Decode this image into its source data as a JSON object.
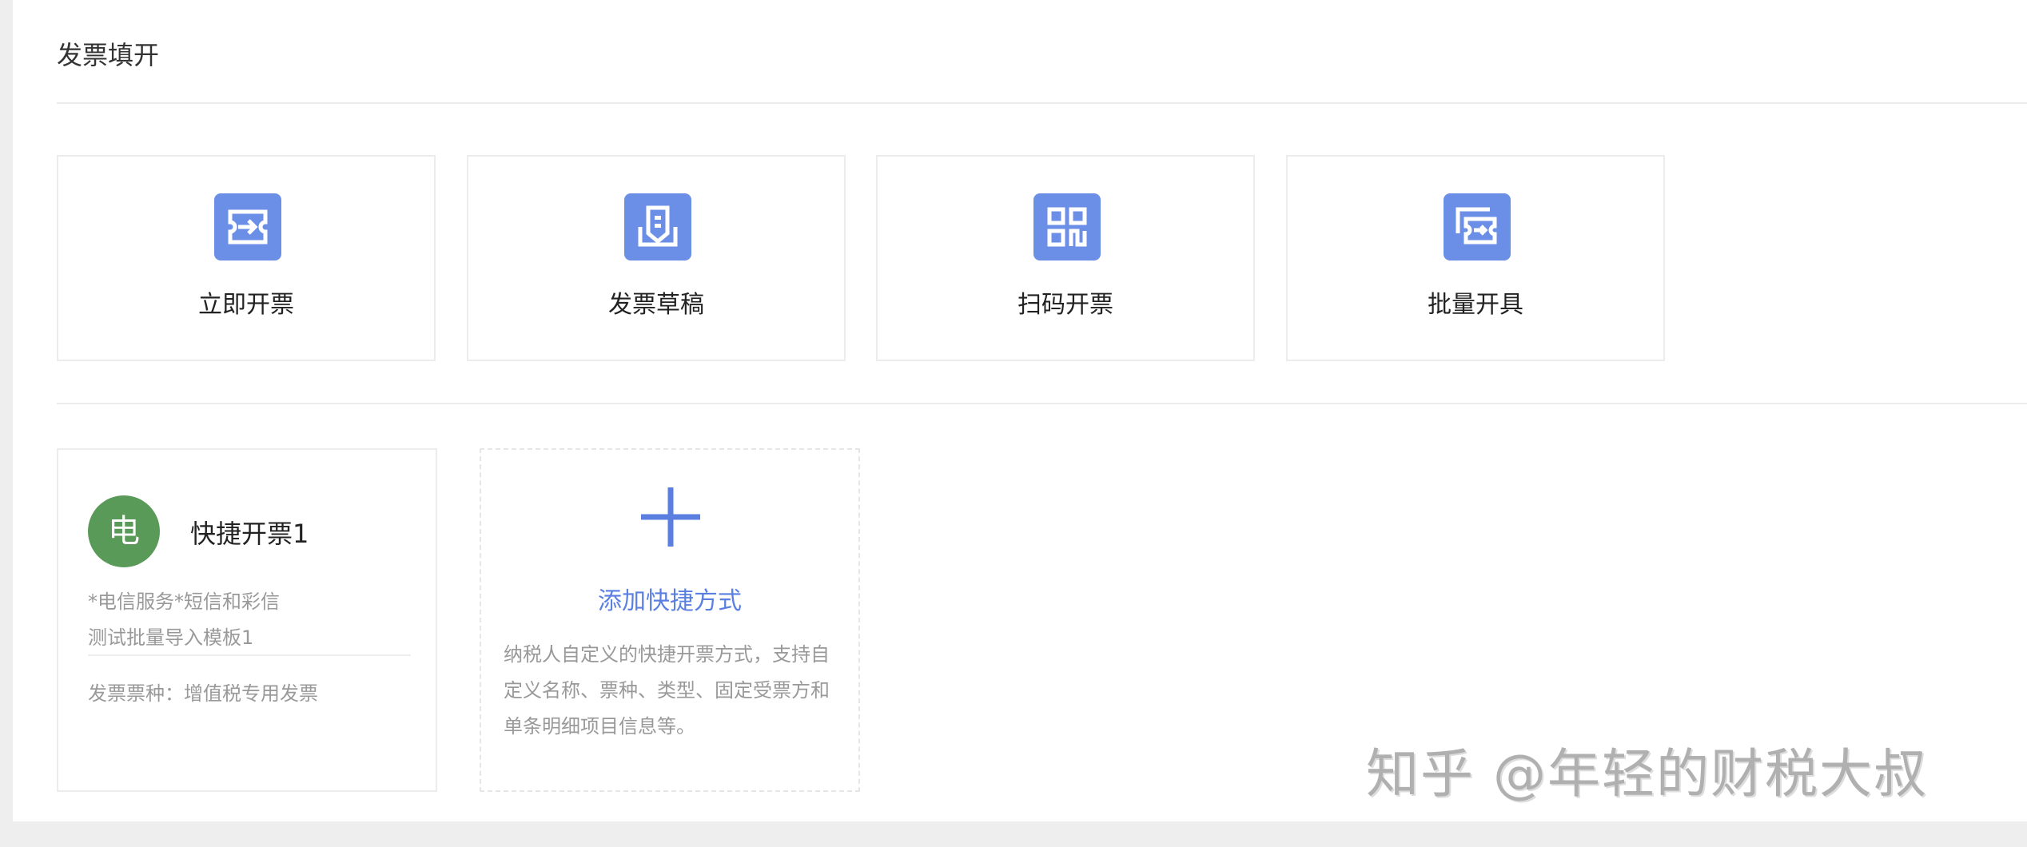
{
  "page": {
    "title": "发票填开"
  },
  "actions": [
    {
      "label": "立即开票",
      "icon": "ticket-arrow-icon"
    },
    {
      "label": "发票草稿",
      "icon": "draft-tray-icon"
    },
    {
      "label": "扫码开票",
      "icon": "qr-code-icon"
    },
    {
      "label": "批量开具",
      "icon": "batch-ticket-icon"
    }
  ],
  "shortcuts": [
    {
      "avatar": "电",
      "title": "快捷开票1",
      "line1": "*电信服务*短信和彩信",
      "line2": "测试批量导入模板1",
      "type": "发票票种：增值税专用发票"
    }
  ],
  "add_shortcut": {
    "label": "添加快捷方式",
    "description": "纳税人自定义的快捷开票方式，支持自定义名称、票种、类型、固定受票方和单条明细项目信息等。"
  },
  "watermark": "知乎 @年轻的财税大叔",
  "colors": {
    "accent": "#6b8fe6",
    "link": "#5b7fe0",
    "avatar": "#5a9a58"
  }
}
